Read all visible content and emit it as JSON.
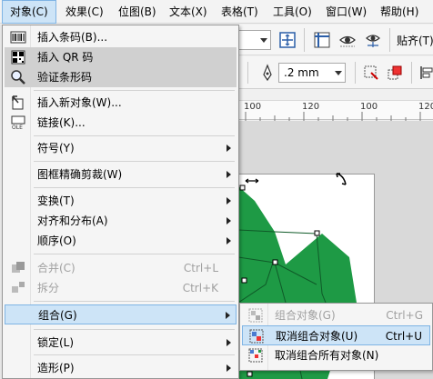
{
  "menubar": {
    "items": [
      {
        "label": "对象(C)"
      },
      {
        "label": "效果(C)"
      },
      {
        "label": "位图(B)"
      },
      {
        "label": "文本(X)"
      },
      {
        "label": "表格(T)"
      },
      {
        "label": "工具(O)"
      },
      {
        "label": "窗口(W)"
      },
      {
        "label": "帮助(H)"
      }
    ]
  },
  "toolbar": {
    "snap_label": "贴齐(T)",
    "outline_width": ".2 mm"
  },
  "ruler": {
    "ticks": [
      "100",
      "120",
      "100",
      "120"
    ]
  },
  "object_menu": {
    "items": [
      {
        "label": "插入条码(B)..."
      },
      {
        "label": "插入 QR 码"
      },
      {
        "label": "验证条形码"
      },
      {
        "label": "插入新对象(W)..."
      },
      {
        "label": "链接(K)..."
      },
      {
        "label": "符号(Y)"
      },
      {
        "label": "图框精确剪裁(W)"
      },
      {
        "label": "变换(T)"
      },
      {
        "label": "对齐和分布(A)"
      },
      {
        "label": "顺序(O)"
      },
      {
        "label": "合并(C)",
        "shortcut": "Ctrl+L"
      },
      {
        "label": "拆分",
        "shortcut": "Ctrl+K"
      },
      {
        "label": "组合(G)"
      },
      {
        "label": "锁定(L)"
      },
      {
        "label": "造形(P)"
      }
    ]
  },
  "group_menu": {
    "items": [
      {
        "label": "组合对象(G)",
        "shortcut": "Ctrl+G"
      },
      {
        "label": "取消组合对象(U)",
        "shortcut": "Ctrl+U"
      },
      {
        "label": "取消组合所有对象(N)"
      }
    ]
  },
  "colors": {
    "leaf_green": "#1e9a45",
    "menu_highlight_blue": "#cde4f7"
  }
}
